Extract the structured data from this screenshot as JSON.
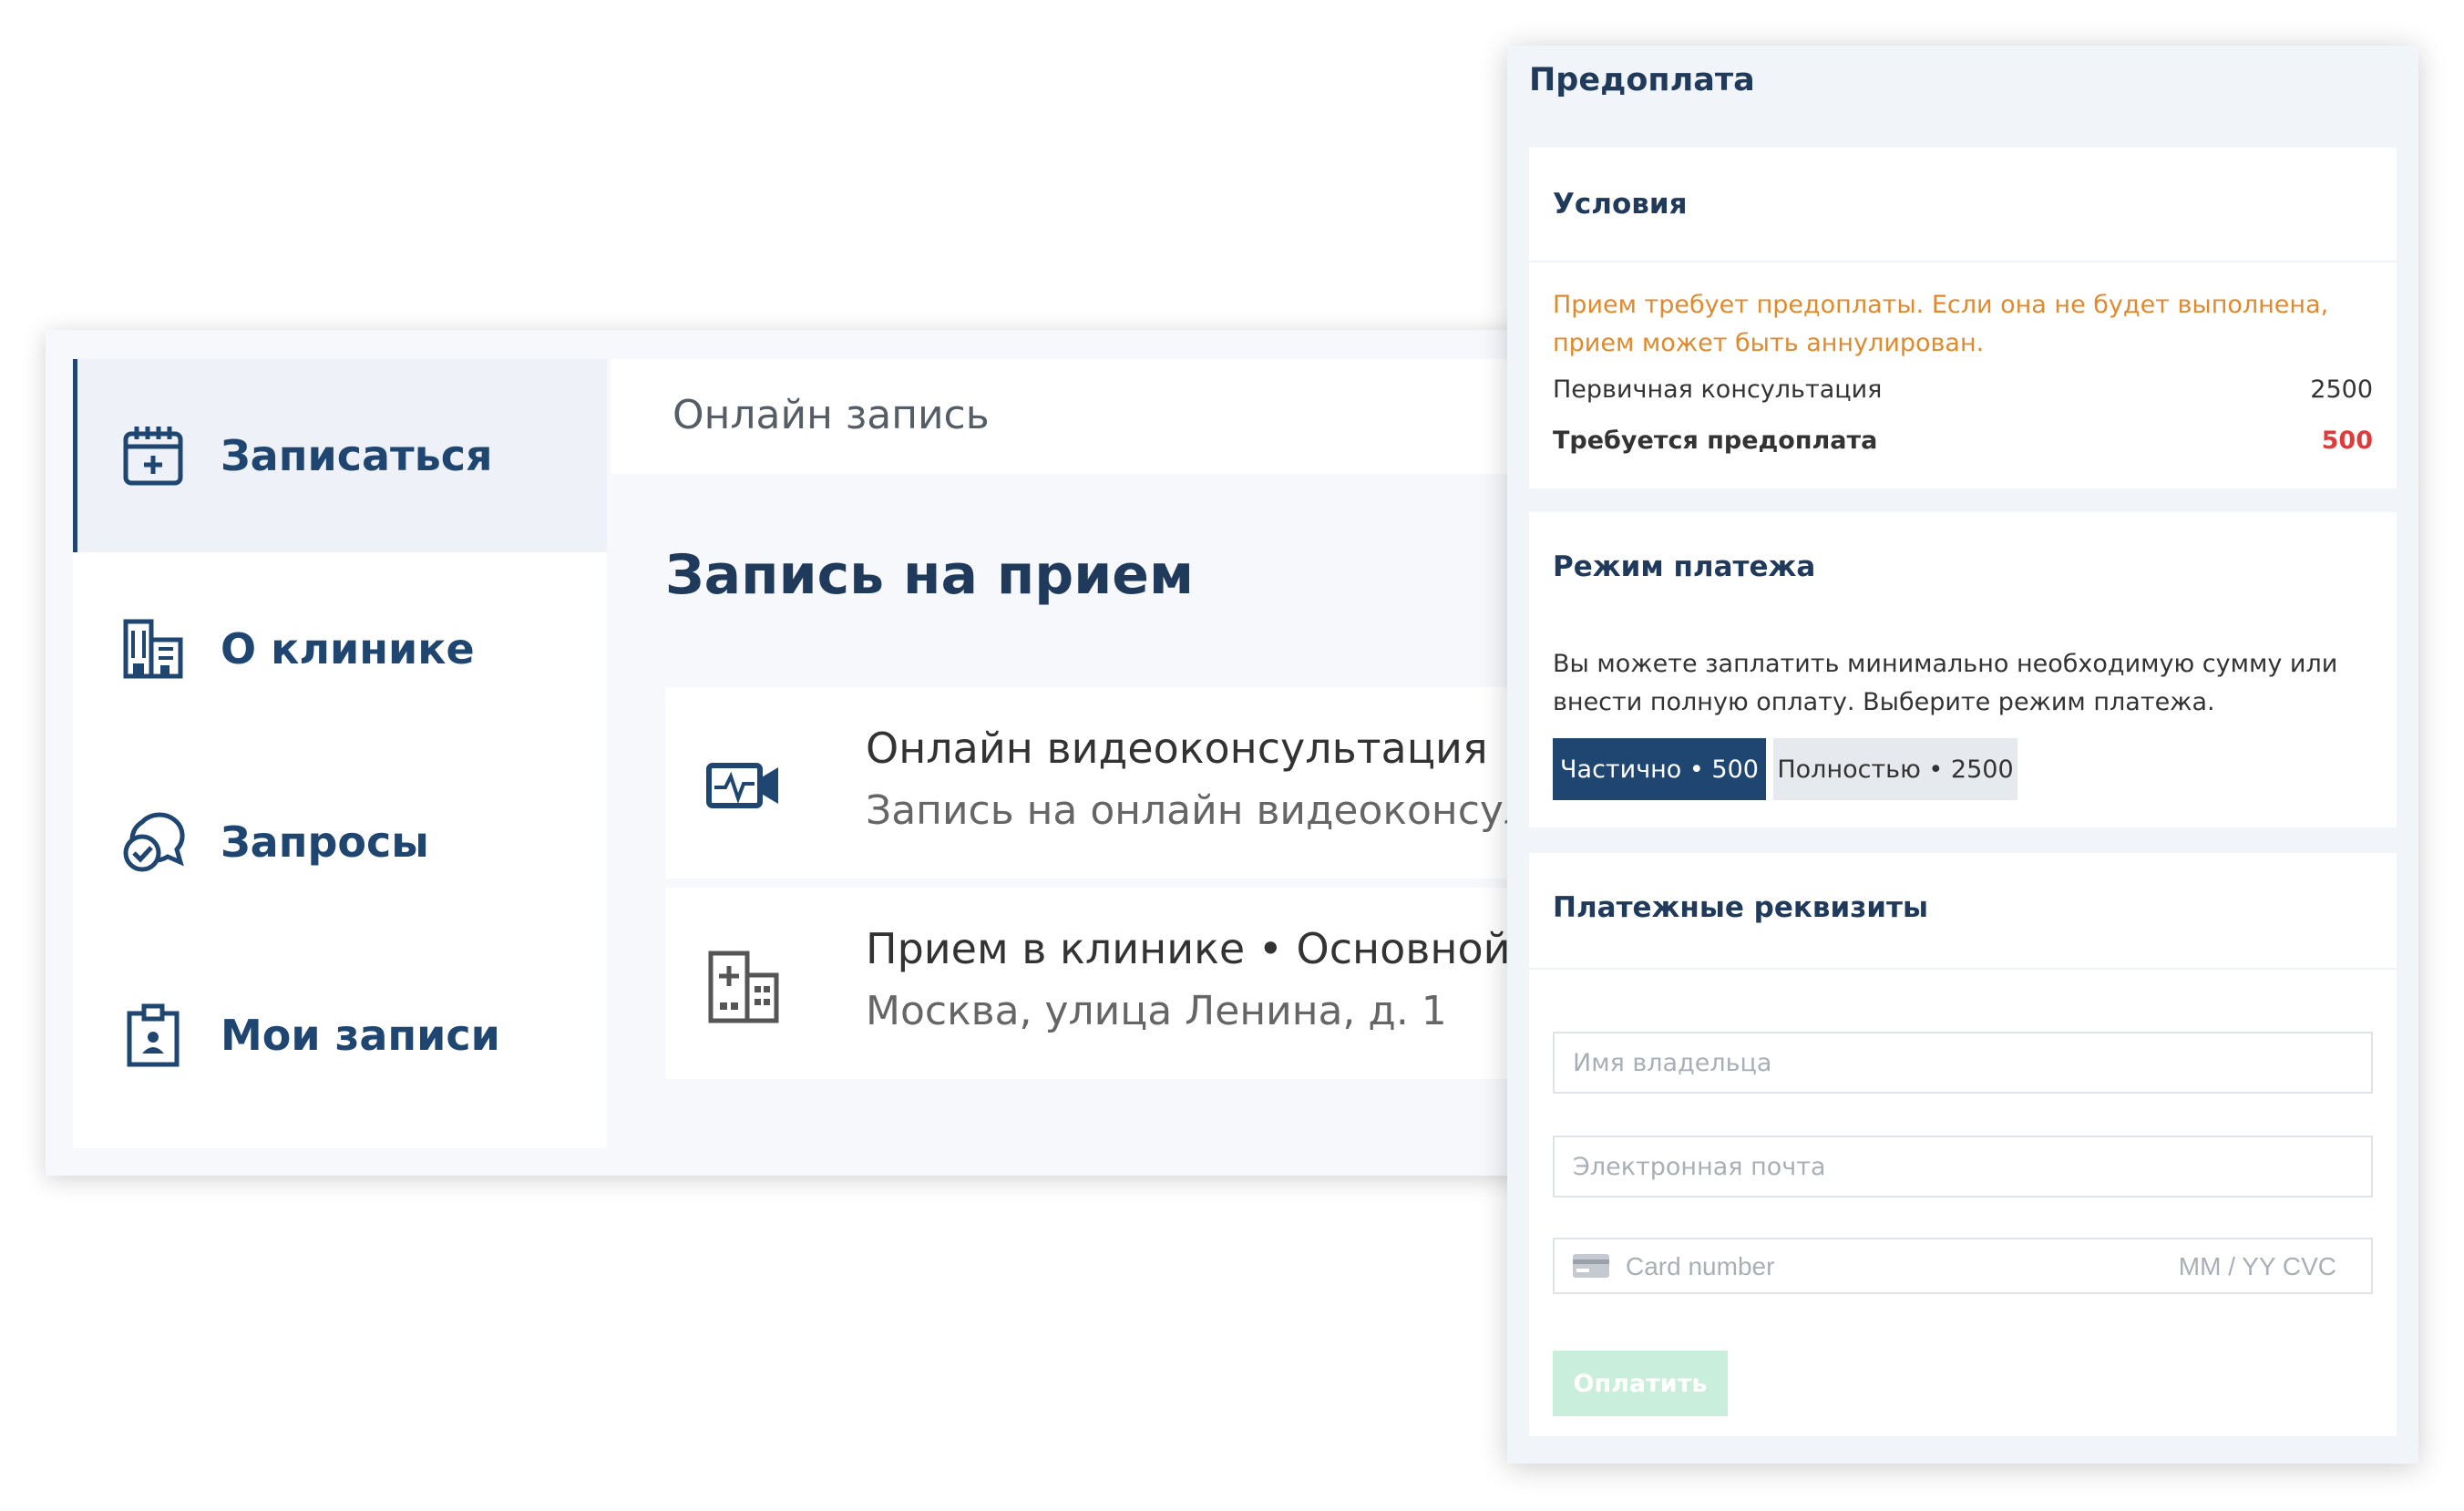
{
  "sidebar": {
    "items": [
      {
        "label": "Записаться",
        "icon": "calendar-plus-icon",
        "active": true
      },
      {
        "label": "О клинике",
        "icon": "building-icon"
      },
      {
        "label": "Запросы",
        "icon": "chat-check-icon"
      },
      {
        "label": "Мои записи",
        "icon": "clipboard-user-icon"
      }
    ]
  },
  "header": {
    "title": "Онлайн запись"
  },
  "main": {
    "title": "Запись на прием",
    "services": [
      {
        "title": "Онлайн видеоконсультация",
        "subtitle": "Запись на онлайн видеоконсультацию",
        "icon": "video-camera-icon"
      },
      {
        "title": "Прием в клинике • Основной филиал",
        "subtitle": "Москва, улица Ленина, д. 1",
        "icon": "hospital-icon"
      }
    ]
  },
  "prepayment": {
    "title": "Предоплата",
    "conditions": {
      "heading": "Условия",
      "warning": "Прием требует предоплаты. Если она не будет выполнена, прием может быть аннулирован.",
      "rows": [
        {
          "label": "Первичная консультация",
          "value": "2500"
        },
        {
          "label": "Требуется предоплата",
          "value": "500"
        }
      ]
    },
    "mode": {
      "heading": "Режим платежа",
      "description": "Вы можете заплатить минимально необходимую сумму или внести полную оплату. Выберите режим платежа.",
      "options": [
        {
          "label": "Частично • 500",
          "selected": true
        },
        {
          "label": "Полностью • 2500",
          "selected": false
        }
      ]
    },
    "details": {
      "heading": "Платежные реквизиты",
      "name_placeholder": "Имя владельца",
      "email_placeholder": "Электронная почта",
      "card_placeholder": "Card number",
      "card_extra_placeholder": "MM / YY  CVC",
      "pay_label": "Оплатить"
    }
  },
  "colors": {
    "brand": "#1f4670",
    "warning": "#e08a2c",
    "danger": "#e03a3a",
    "pay_disabled": "#c9eedb"
  }
}
